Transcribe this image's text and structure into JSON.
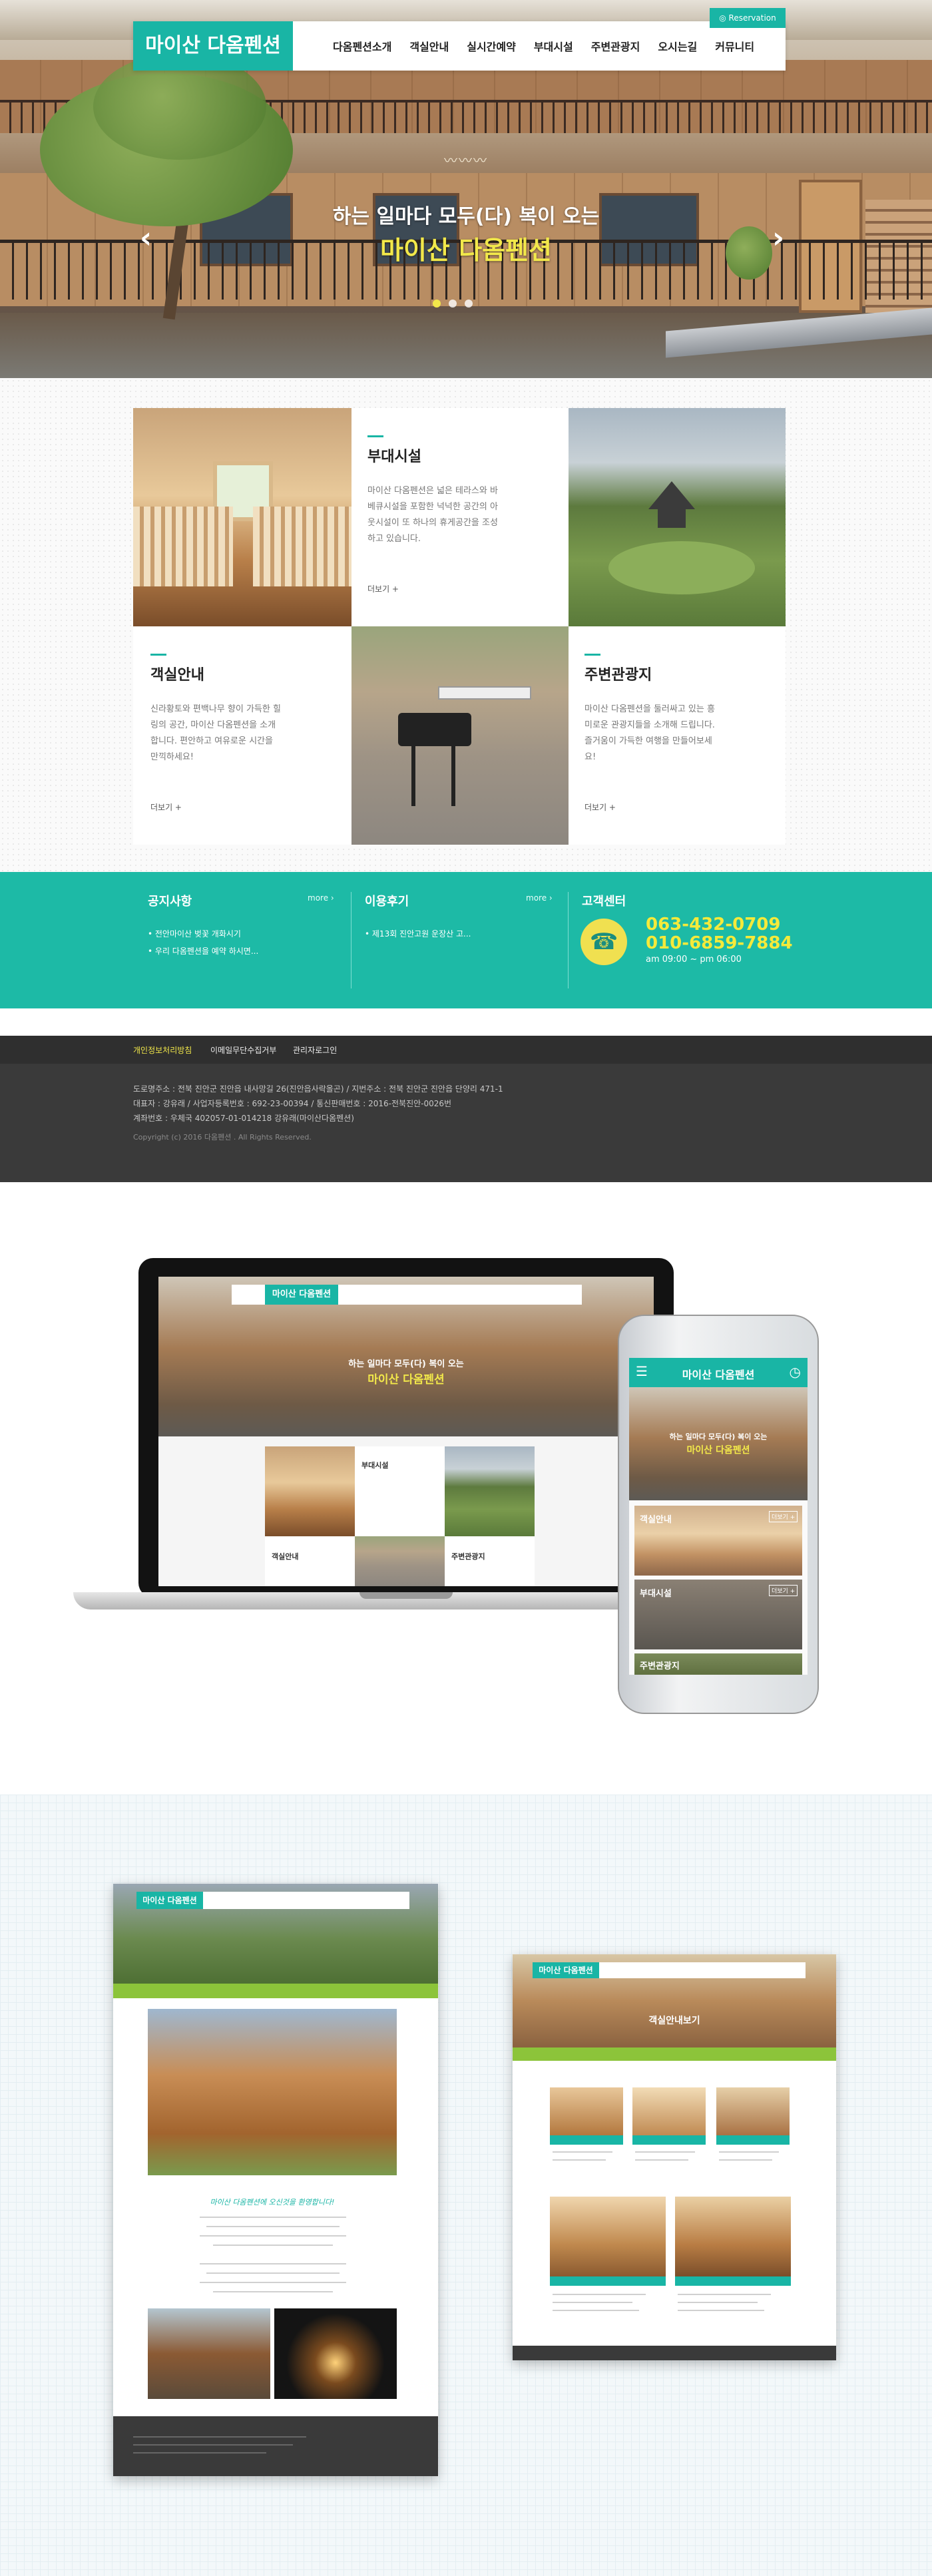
{
  "header": {
    "logo": "마이산 다옴펜션",
    "reservation": "Reservation",
    "menu": [
      "다옴펜션소개",
      "객실안내",
      "실시간예약",
      "부대시설",
      "주변관광지",
      "오시는길",
      "커뮤니티"
    ]
  },
  "hero": {
    "line1": "하는 일마다 모두(다) 복이 오는",
    "line2": "마이산 다옴펜션",
    "prev": "‹",
    "next": "›",
    "wave": "〰〰〰"
  },
  "features": [
    {
      "title": "부대시설",
      "desc": "마이산 다옴펜션은 넓은 테라스와 바베큐시설을 포함한 넉넉한 공간의 아웃시설이 또 하나의 휴게공간을 조성하고 있습니다.",
      "more": "더보기 +"
    },
    {
      "title": "객실안내",
      "desc": "신라황토와 편백나무 향이 가득한 힐링의 공간, 마이산 다옴펜션을 소개합니다. 편안하고 여유로운 시간을 만끽하세요!",
      "more": "더보기 +"
    },
    {
      "title": "주변관광지",
      "desc": "마이산 다옴펜션을 둘러싸고 있는 흥미로운 관광지들을 소개해 드립니다. 즐거움이 가득한 여행을 만들어보세요!",
      "more": "더보기 +"
    }
  ],
  "band": {
    "notice": {
      "title": "공지사항",
      "more": "more ›",
      "items": [
        "• 전안마이산 벚꽃 개화시기",
        "• 우리 다옴펜션을 예약 하시면..."
      ]
    },
    "reviews": {
      "title": "이용후기",
      "more": "more ›",
      "items": [
        "• 제13회 진안고원 운장산 고..."
      ]
    },
    "support": {
      "title": "고객센터",
      "tel1": "063-432-0709",
      "tel2": "010-6859-7884",
      "hours": "am 09:00 ~ pm 06:00",
      "icon": "☎"
    }
  },
  "footer": {
    "links": [
      "개인정보처리방침",
      "이메일무단수집거부",
      "관리자로그인"
    ],
    "info": [
      "도로명주소 : 전북 진안군 진안읍 내사망길 26(진안읍사락올곤) / 지번주소 : 전북 진안군 진안읍 단양리 471-1",
      "대표자 : 강유래 / 사업자등록번호 : 692-23-00394 / 통신판매번호 : 2016-전북진안-0026번",
      "계좌번호 : 우체국 402057-01-014218 강유래(마이산다옴펜션)"
    ],
    "copyright": "Copyright (c) 2016 다옴펜션 . All Rights Reserved."
  },
  "mockups": {
    "laptop_logo": "마이산 다옴펜션",
    "laptop_hero1": "하는 일마다 모두(다) 복이 오는",
    "laptop_hero2": "마이산 다옴펜션",
    "laptop_cards": [
      "부대시설",
      "객실안내",
      "주변관광지"
    ],
    "phone_logo": "마이산 다옴펜션",
    "phone_hero1": "하는 일마다 모두(다) 복이 오는",
    "phone_hero2": "마이산 다옴펜션",
    "phone_cards": [
      {
        "title": "객실안내",
        "btn": "더보기 +"
      },
      {
        "title": "부대시설",
        "btn": "더보기 +"
      },
      {
        "title": "주변관광지",
        "btn": ""
      }
    ],
    "print_left_logo": "마이산 다옴펜션",
    "print_left_script": "마이산 다옴펜션에 오신것을 환영합니다!",
    "print_right_logo": "마이산 다옴펜션",
    "print_right_hero": "객실안내보기"
  },
  "colors": {
    "accent": "#19b5a5",
    "highlight": "#f2e84a",
    "footer": "#3a3a3a"
  }
}
